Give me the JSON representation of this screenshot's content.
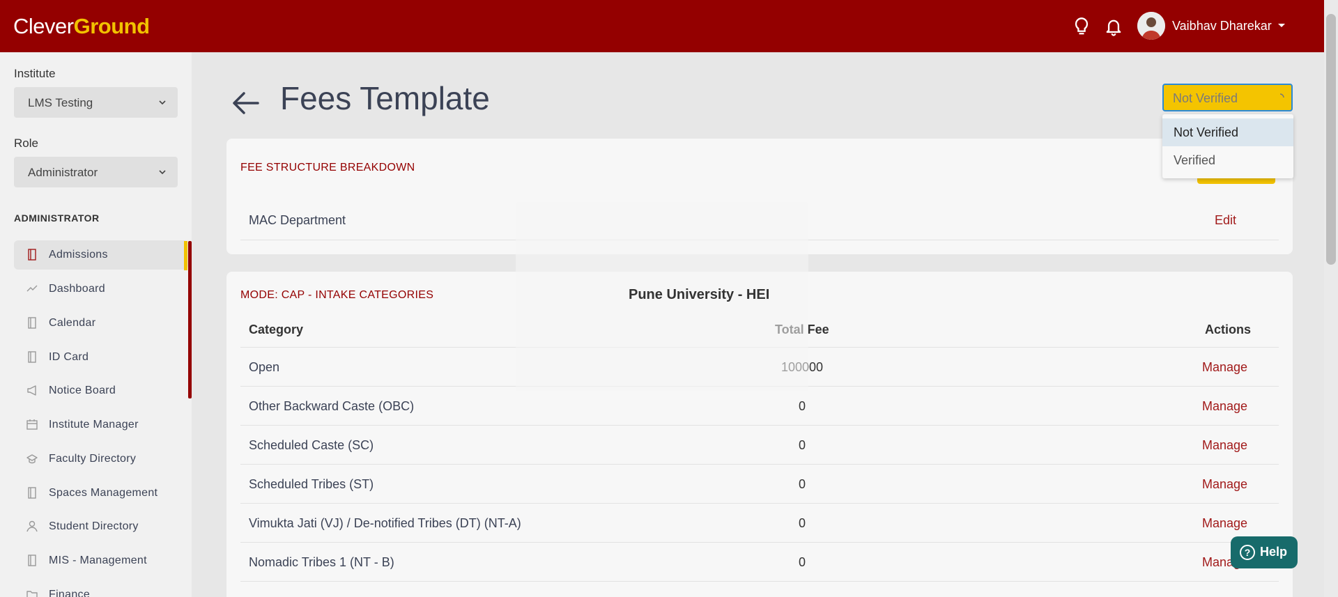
{
  "header": {
    "logo_part1": "Clever",
    "logo_part2": "Ground",
    "user_name": "Vaibhav Dharekar"
  },
  "sidebar": {
    "institute_label": "Institute",
    "institute_value": "LMS Testing",
    "role_label": "Role",
    "role_value": "Administrator",
    "section_heading": "ADMINISTRATOR",
    "items": [
      {
        "label": "Admissions",
        "icon": "book-icon",
        "active": true
      },
      {
        "label": "Dashboard",
        "icon": "trend-icon",
        "active": false
      },
      {
        "label": "Calendar",
        "icon": "book-icon",
        "active": false
      },
      {
        "label": "ID Card",
        "icon": "book-icon",
        "active": false
      },
      {
        "label": "Notice Board",
        "icon": "megaphone-icon",
        "active": false
      },
      {
        "label": "Institute Manager",
        "icon": "calendar-icon",
        "active": false
      },
      {
        "label": "Faculty Directory",
        "icon": "graduation-cap-icon",
        "active": false
      },
      {
        "label": "Spaces Management",
        "icon": "book-icon",
        "active": false
      },
      {
        "label": "Student Directory",
        "icon": "user-icon",
        "active": false
      },
      {
        "label": "MIS - Management",
        "icon": "book-icon",
        "active": false
      },
      {
        "label": "Finance",
        "icon": "folder-icon",
        "active": false
      }
    ]
  },
  "main": {
    "title": "Fees Template",
    "status": {
      "selected": "Not Verified",
      "options": [
        "Not Verified",
        "Verified"
      ]
    },
    "fee_structure": {
      "title": "FEE STRUCTURE BREAKDOWN",
      "department": "MAC Department",
      "edit_label": "Edit"
    },
    "intake": {
      "title": "MODE: CAP - INTAKE CATEGORIES",
      "org_name": "Pune University - HEI",
      "columns": [
        "Category",
        "Total Fee",
        "Actions"
      ],
      "rows": [
        {
          "category": "Open",
          "fee": "100000",
          "action": "Manage"
        },
        {
          "category": "Other Backward Caste (OBC)",
          "fee": "0",
          "action": "Manage"
        },
        {
          "category": "Scheduled Caste (SC)",
          "fee": "0",
          "action": "Manage"
        },
        {
          "category": "Scheduled Tribes (ST)",
          "fee": "0",
          "action": "Manage"
        },
        {
          "category": "Vimukta Jati (VJ) / De-notified Tribes (DT) (NT-A)",
          "fee": "0",
          "action": "Manage"
        },
        {
          "category": "Nomadic Tribes 1 (NT - B)",
          "fee": "0",
          "action": "Manage"
        }
      ]
    }
  },
  "help_label": "Help",
  "colors": {
    "brand": "#940000",
    "accent": "#f2c200",
    "help": "#176b6b"
  }
}
